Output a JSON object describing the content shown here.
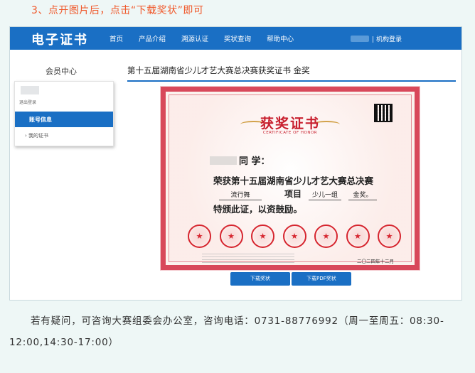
{
  "step": {
    "title": "3、点开图片后，点击“下载奖状”即可"
  },
  "header": {
    "logo": "电子证书",
    "nav": [
      "首页",
      "产品介绍",
      "溯源认证",
      "奖状查询",
      "帮助中心"
    ],
    "login_label": "| 机构登录"
  },
  "sidebar": {
    "title": "会员中心",
    "logout": "退出登录",
    "active_item": "账号信息",
    "item": "› 我的证书"
  },
  "main": {
    "heading": "第十五届湖南省少儿才艺大赛总决赛获奖证书 金奖"
  },
  "certificate": {
    "title": "获奖证书",
    "subtitle": "CERTIFICATE OF HONOR",
    "addressee": "同 学：",
    "honor_line": "荣获第十五届湖南省少儿才艺大赛总决赛",
    "category": "流行舞",
    "project_label": "项目",
    "group": "少儿一组",
    "award": "金奖。",
    "encourage": "特颁此证，以资鼓励。",
    "date": "二〇二四年十二月",
    "seal_count": 7
  },
  "buttons": {
    "download": "下载奖状",
    "download_pdf": "下载PDF奖状"
  },
  "footer": {
    "note": "若有疑问，可咨询大赛组委会办公室，咨询电话：0731-88776992（周一至周五：08:30-12:00,14:30-17:00）"
  },
  "colors": {
    "brand_blue": "#1a6fc4",
    "accent_orange": "#f0582a",
    "cert_red": "#d8485a"
  }
}
